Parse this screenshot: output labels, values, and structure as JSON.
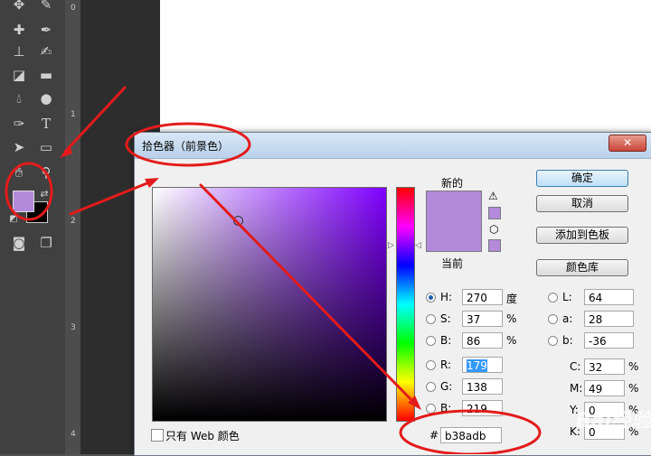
{
  "dialog": {
    "title": "拾色器（前景色）",
    "close": "✕",
    "swatch_new_label": "新的",
    "swatch_current_label": "当前",
    "new_color": "#b38adb",
    "current_color": "#b38adb",
    "warning_icon": "⚠",
    "cube_icon": "⬡",
    "buttons": {
      "ok": "确定",
      "cancel": "取消",
      "add_swatch": "添加到色板",
      "library": "颜色库"
    },
    "hsb": [
      {
        "label": "H:",
        "value": "270",
        "unit": "度"
      },
      {
        "label": "S:",
        "value": "37",
        "unit": "%"
      },
      {
        "label": "B:",
        "value": "86",
        "unit": "%"
      }
    ],
    "rgb": [
      {
        "label": "R:",
        "value": "179"
      },
      {
        "label": "G:",
        "value": "138"
      },
      {
        "label": "B:",
        "value": "219"
      }
    ],
    "lab": [
      {
        "label": "L:",
        "value": "64"
      },
      {
        "label": "a:",
        "value": "28"
      },
      {
        "label": "b:",
        "value": "-36"
      }
    ],
    "cmyk": [
      {
        "label": "C:",
        "value": "32",
        "unit": "%"
      },
      {
        "label": "M:",
        "value": "49",
        "unit": "%"
      },
      {
        "label": "Y:",
        "value": "0",
        "unit": "%"
      },
      {
        "label": "K:",
        "value": "0",
        "unit": "%"
      }
    ],
    "hex_label": "#",
    "hex_value": "b38adb",
    "web_only_label": "只有 Web 颜色"
  },
  "ruler": {
    "marks": [
      "0",
      "1",
      "2",
      "3",
      "4"
    ]
  },
  "toolbar": {
    "foreground_color": "#b38adb",
    "background_color": "#000000",
    "tools": [
      "move",
      "brush",
      "healing",
      "clone-stamp",
      "history-brush",
      "eraser",
      "gradient",
      "blur",
      "dodge",
      "pen",
      "type",
      "path-select",
      "shape",
      "hand",
      "zoom",
      "quick-mask",
      "screen-mode"
    ]
  },
  "watermark": "Bai经验"
}
